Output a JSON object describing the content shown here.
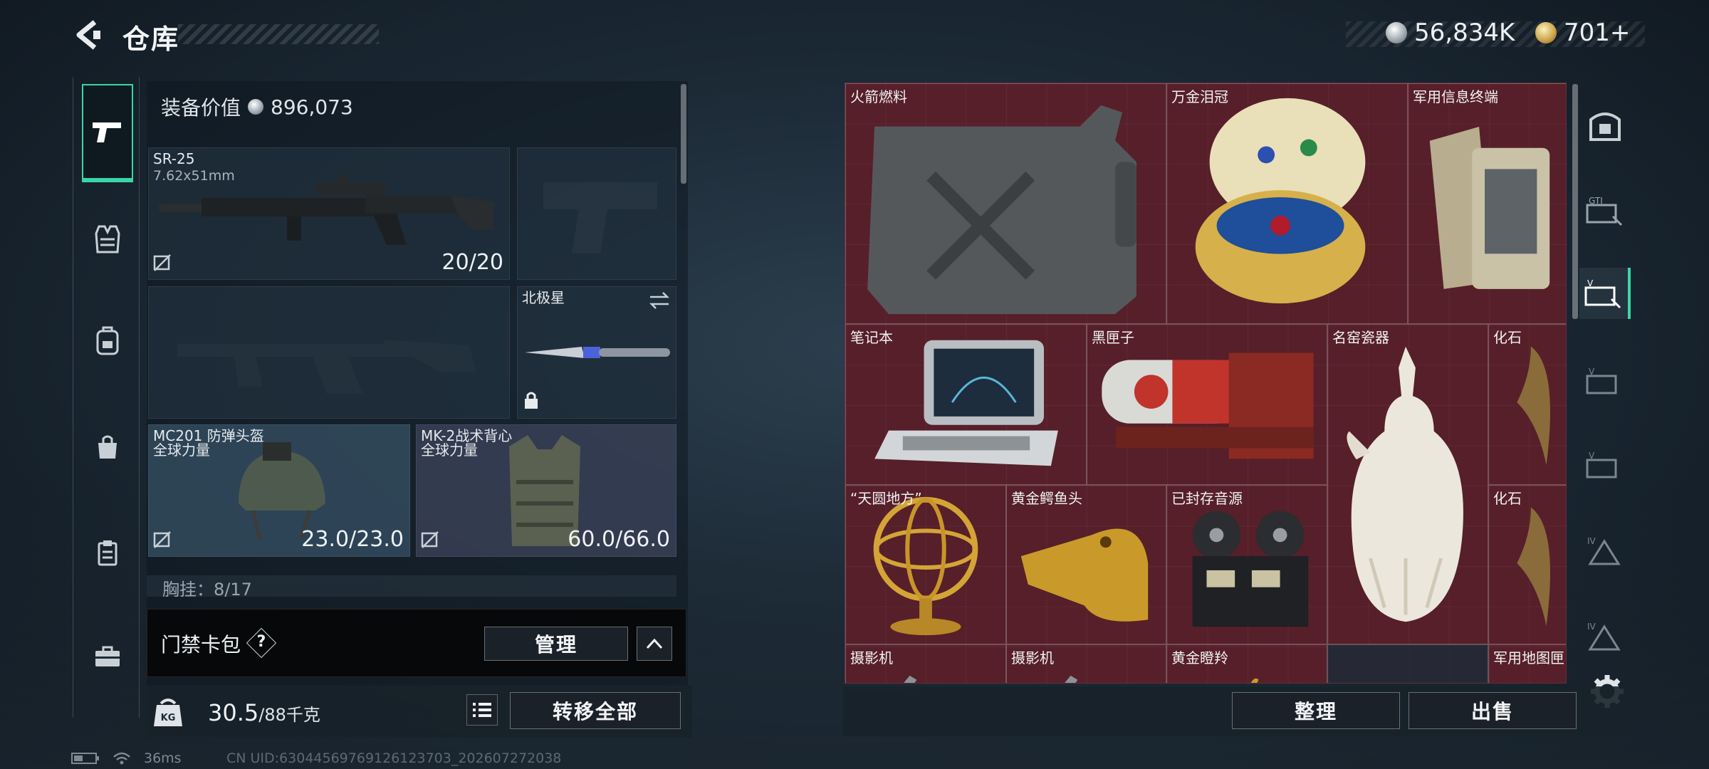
{
  "header": {
    "title": "仓库",
    "currency_silver": "56,834K",
    "currency_gold": "701+"
  },
  "sidebar": {
    "items": [
      "pistol-icon",
      "armor-vest-icon",
      "backpack-icon",
      "bag-icon",
      "clipboard-icon",
      "briefcase-icon"
    ]
  },
  "loadout": {
    "equip_value_label": "装备价值",
    "equip_value": "896,073",
    "primary": {
      "name": "SR-25",
      "caliber": "7.62x51mm",
      "ammo": "20/20"
    },
    "melee": {
      "name": "北极星"
    },
    "helmet": {
      "name": "MC201 防弹头盔",
      "faction": "全球力量",
      "durability": "23.0/23.0"
    },
    "vest": {
      "name": "MK-2战术背心",
      "faction": "全球力量",
      "durability": "60.0/66.0"
    },
    "chest_rig": "胸挂：8/17"
  },
  "keycard": {
    "label": "门禁卡包",
    "help": "?",
    "manage": "管理"
  },
  "footer_left": {
    "weight": "30.5",
    "weight_max": "/88千克",
    "kg_label": "KG",
    "transfer_all": "转移全部"
  },
  "grid": {
    "items": [
      {
        "id": "fuel",
        "label": "火箭燃料"
      },
      {
        "id": "crown",
        "label": "万金泪冠"
      },
      {
        "id": "terminal",
        "label": "军用信息终端"
      },
      {
        "id": "laptop",
        "label": "笔记本"
      },
      {
        "id": "blackbox",
        "label": "黑匣子"
      },
      {
        "id": "vase",
        "label": "名窑瓷器"
      },
      {
        "id": "fossil1",
        "label": "化石"
      },
      {
        "id": "armillary",
        "label": "“天圆地方”"
      },
      {
        "id": "croc",
        "label": "黄金鳄鱼头"
      },
      {
        "id": "reel",
        "label": "已封存音源"
      },
      {
        "id": "fossil2",
        "label": "化石"
      },
      {
        "id": "camera1",
        "label": "摄影机"
      },
      {
        "id": "camera2",
        "label": "摄影机"
      },
      {
        "id": "antelope",
        "label": "黄金瞪羚"
      },
      {
        "id": "map",
        "label": "军用地图匣"
      }
    ]
  },
  "right_tabs": [
    "safe-icon",
    "case-gti-icon",
    "case-v-icon",
    "case-v2-icon",
    "case-v3-icon",
    "case-iv-icon",
    "case-iv2-icon"
  ],
  "footer_right": {
    "sort": "整理",
    "sell": "出售"
  },
  "status": {
    "ping": "36ms",
    "uid": "CN UID:630445697691261237​03_202607272038"
  },
  "colors": {
    "accent": "#3bd6a8",
    "grid_bg": "#4a1b24"
  }
}
